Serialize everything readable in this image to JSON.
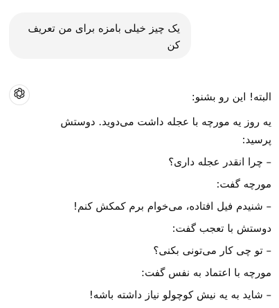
{
  "user_message": {
    "text": "یک چیز خیلی بامزه برای من تعریف کن"
  },
  "assistant": {
    "avatar_icon": "openai-logo-icon",
    "lines": [
      "البته! این رو بشنو:",
      "یه روز یه مورچه با عجله داشت می‌دوید. دوستش پرسید:",
      "– چرا انقدر عجله داری؟",
      "مورچه گفت:",
      "– شنیدم فیل افتاده، می‌خوام برم کمکش کنم!",
      "دوستش با تعجب گفت:",
      "– تو چی کار می‌تونی بکنی؟",
      "مورچه با اعتماد به نفس گفت:",
      "– شاید به یه نیش کوچولو نیاز داشته باشه!"
    ]
  },
  "colors": {
    "user_bubble_bg": "#f4f4f4",
    "text": "#0d0d0d",
    "avatar_border": "#e3e3e3"
  }
}
